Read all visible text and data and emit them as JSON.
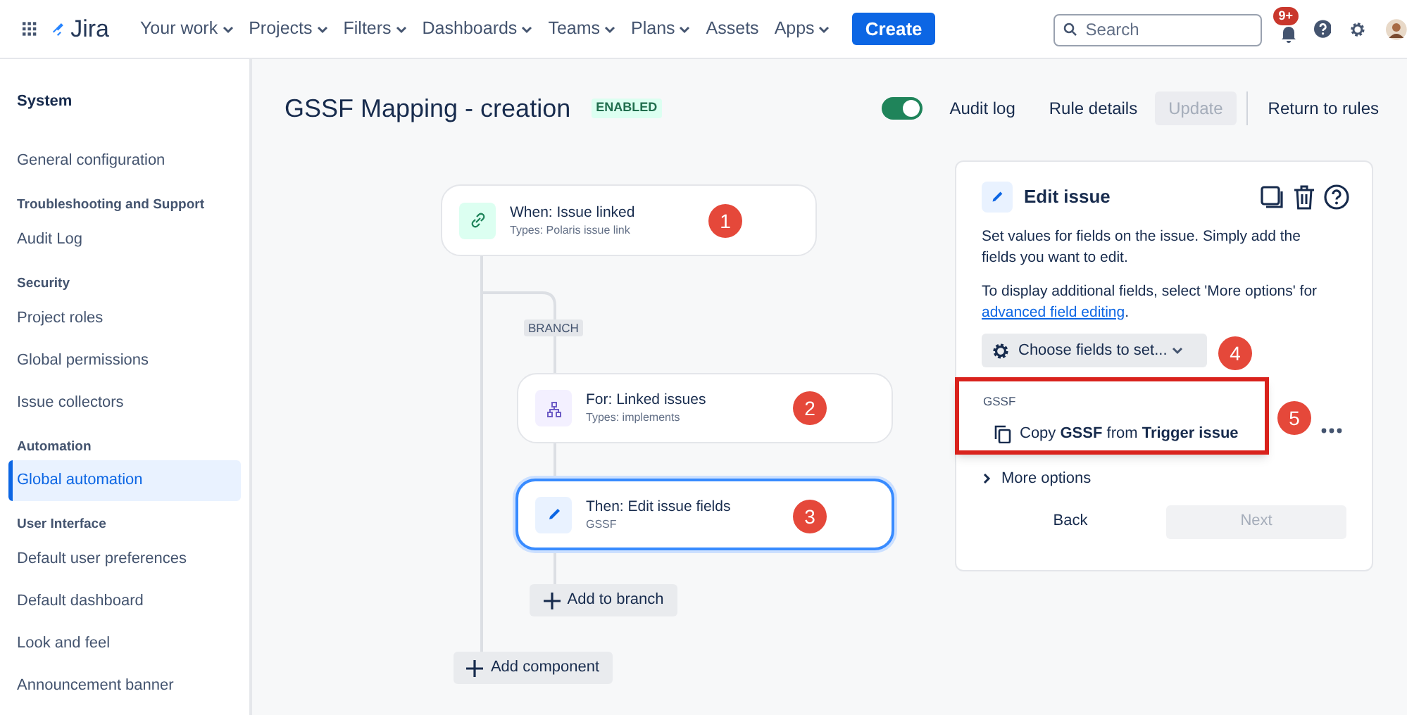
{
  "top_nav": {
    "app_name": "Jira",
    "menus": [
      {
        "label": "Your work",
        "has_menu": true
      },
      {
        "label": "Projects",
        "has_menu": true
      },
      {
        "label": "Filters",
        "has_menu": true
      },
      {
        "label": "Dashboards",
        "has_menu": true
      },
      {
        "label": "Teams",
        "has_menu": true
      },
      {
        "label": "Plans",
        "has_menu": true
      },
      {
        "label": "Assets",
        "has_menu": false
      },
      {
        "label": "Apps",
        "has_menu": true
      }
    ],
    "create": "Create",
    "search": {
      "placeholder": "Search"
    },
    "notification_badge": "9+"
  },
  "sidebar": {
    "items": [
      {
        "kind": "title",
        "label": "System"
      },
      {
        "kind": "item",
        "label": "General configuration",
        "selected": false
      },
      {
        "kind": "section",
        "label": "Troubleshooting and Support"
      },
      {
        "kind": "item",
        "label": "Audit Log",
        "selected": false
      },
      {
        "kind": "section",
        "label": "Security"
      },
      {
        "kind": "item",
        "label": "Project roles",
        "selected": false
      },
      {
        "kind": "item",
        "label": "Global permissions",
        "selected": false
      },
      {
        "kind": "item",
        "label": "Issue collectors",
        "selected": false
      },
      {
        "kind": "section",
        "label": "Automation"
      },
      {
        "kind": "item",
        "label": "Global automation",
        "selected": true
      },
      {
        "kind": "section",
        "label": "User Interface"
      },
      {
        "kind": "item",
        "label": "Default user preferences",
        "selected": false
      },
      {
        "kind": "item",
        "label": "Default dashboard",
        "selected": false
      },
      {
        "kind": "item",
        "label": "Look and feel",
        "selected": false
      },
      {
        "kind": "item",
        "label": "Announcement banner",
        "selected": false
      }
    ]
  },
  "rule": {
    "title": "GSSF Mapping - creation",
    "status": "ENABLED",
    "enabled": true,
    "actions": [
      "Audit log",
      "Rule details"
    ],
    "update": {
      "label": "Update",
      "disabled": true
    },
    "return": "Return to rules"
  },
  "flow": {
    "nodes": [
      {
        "kind": "trigger",
        "title": "When: Issue linked",
        "subtitle": "Types: Polaris issue link",
        "selected": false,
        "marker": "1"
      },
      {
        "kind": "branch",
        "title": "For: Linked issues",
        "subtitle": "Types: implements",
        "selected": false,
        "marker": "2"
      },
      {
        "kind": "action",
        "title": "Then: Edit issue fields",
        "subtitle": "GSSF",
        "selected": true,
        "marker": "3"
      }
    ],
    "branch_label": "BRANCH",
    "add_to_branch": "Add to branch",
    "add_component": "Add component"
  },
  "panel": {
    "title": "Edit issue",
    "description": "Set values for fields on the issue. Simply add the fields you want to edit.",
    "more_text": "To display additional fields, select 'More options' for",
    "link": "advanced field editing",
    "link_end": ".",
    "choose": {
      "label": "Choose fields to set...",
      "marker": "4"
    },
    "field": {
      "label": "GSSF",
      "value": "Copy **GSSF** from **Trigger issue**",
      "highlighted": true,
      "marker": "5"
    },
    "more_options": "More options",
    "back": "Back",
    "next": {
      "label": "Next",
      "disabled": true
    }
  }
}
